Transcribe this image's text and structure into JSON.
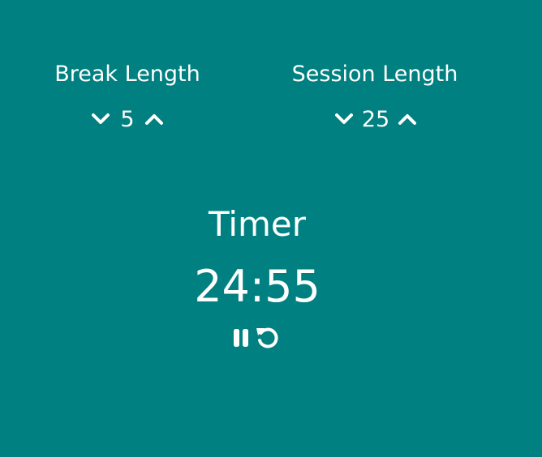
{
  "break": {
    "label": "Break Length",
    "value": "5"
  },
  "session": {
    "label": "Session Length",
    "value": "25"
  },
  "timer": {
    "label": "Timer",
    "time_left": "24:55"
  },
  "icons": {
    "decrement": "chevron-down-icon",
    "increment": "chevron-up-icon",
    "pause": "pause-icon",
    "reset": "reset-icon"
  },
  "colors": {
    "background": "#008080",
    "foreground": "#ffffff"
  }
}
